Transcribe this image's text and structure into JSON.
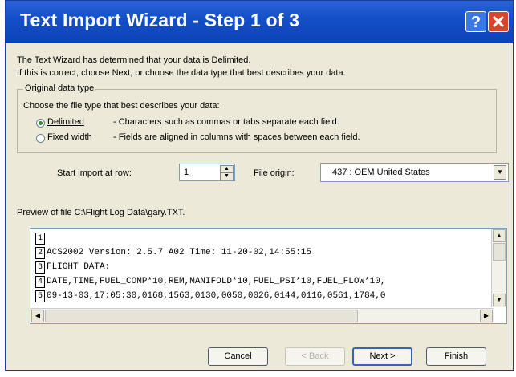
{
  "window": {
    "title": "Text Import Wizard - Step 1 of 3",
    "help_label": "?",
    "close_label": "✕"
  },
  "intro": {
    "line1": "The Text Wizard has determined that your data is Delimited.",
    "line2": "If this is correct, choose Next, or choose the data type that best describes your data."
  },
  "original_data_type": {
    "group_label": "Original data type",
    "prompt": "Choose the file type that best describes your data:",
    "options": [
      {
        "label": "Delimited",
        "description": "- Characters such as commas or tabs separate each field.",
        "selected": true
      },
      {
        "label": "Fixed width",
        "description": "- Fields are aligned in columns with spaces between each field.",
        "selected": false
      }
    ]
  },
  "start_import": {
    "label": "Start import at row:",
    "value": "1"
  },
  "file_origin": {
    "label": "File origin:",
    "value": "437 : OEM United States"
  },
  "preview": {
    "label": "Preview of file C:\\Flight Log Data\\gary.TXT.",
    "rows": [
      {
        "num": "1",
        "text": ""
      },
      {
        "num": "2",
        "text": "ACS2002 Version: 2.5.7 A02  Time: 11-20-02,14:55:15"
      },
      {
        "num": "3",
        "text": "FLIGHT DATA:"
      },
      {
        "num": "4",
        "text": "DATE,TIME,FUEL_COMP*10,REM,MANIFOLD*10,FUEL_PSI*10,FUEL_FLOW*10,"
      },
      {
        "num": "5",
        "text": "09-13-03,17:05:30,0168,1563,0130,0050,0026,0144,0116,0561,1784,0"
      }
    ]
  },
  "buttons": {
    "cancel": "Cancel",
    "back": "< Back",
    "next": "Next >",
    "finish": "Finish"
  },
  "colors": {
    "titlebar": "#1450c8",
    "dialog_bg": "#ece9d8",
    "close_button": "#d6452c"
  }
}
